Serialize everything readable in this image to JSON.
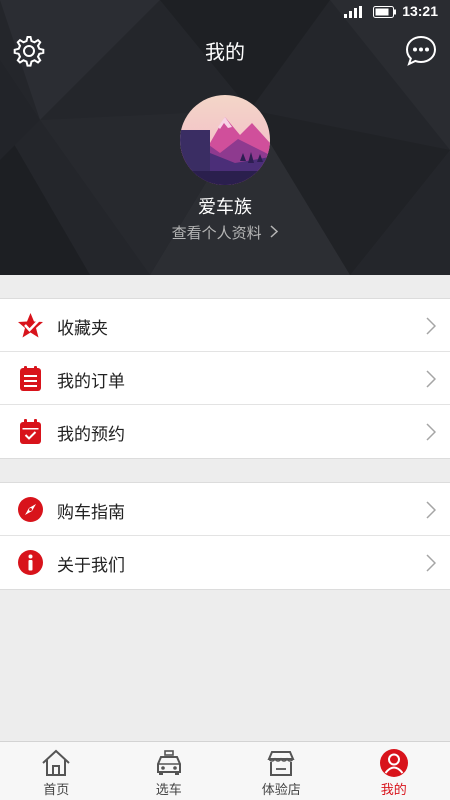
{
  "status_bar": {
    "time": "13:21",
    "icons": [
      "signal-icon",
      "battery-icon"
    ]
  },
  "header": {
    "title": "我的",
    "username": "爱车族",
    "profile_link": "查看个人资料",
    "left_icon": "gear-icon",
    "right_icon": "chat-bubble-icon"
  },
  "menu_groups": [
    {
      "items": [
        {
          "label": "收藏夹",
          "icon": "star-check-icon"
        },
        {
          "label": "我的订单",
          "icon": "clipboard-list-icon"
        },
        {
          "label": "我的预约",
          "icon": "calendar-check-icon"
        }
      ]
    },
    {
      "items": [
        {
          "label": "购车指南",
          "icon": "compass-icon"
        },
        {
          "label": "关于我们",
          "icon": "info-icon"
        }
      ]
    }
  ],
  "tab_bar": {
    "tabs": [
      {
        "label": "首页",
        "icon": "home-icon",
        "active": false
      },
      {
        "label": "选车",
        "icon": "car-icon",
        "active": false
      },
      {
        "label": "体验店",
        "icon": "store-icon",
        "active": false
      },
      {
        "label": "我的",
        "icon": "user-icon",
        "active": true
      }
    ]
  },
  "colors": {
    "accent": "#d8131b",
    "header_bg": "#23252a",
    "page_bg": "#ededed"
  }
}
